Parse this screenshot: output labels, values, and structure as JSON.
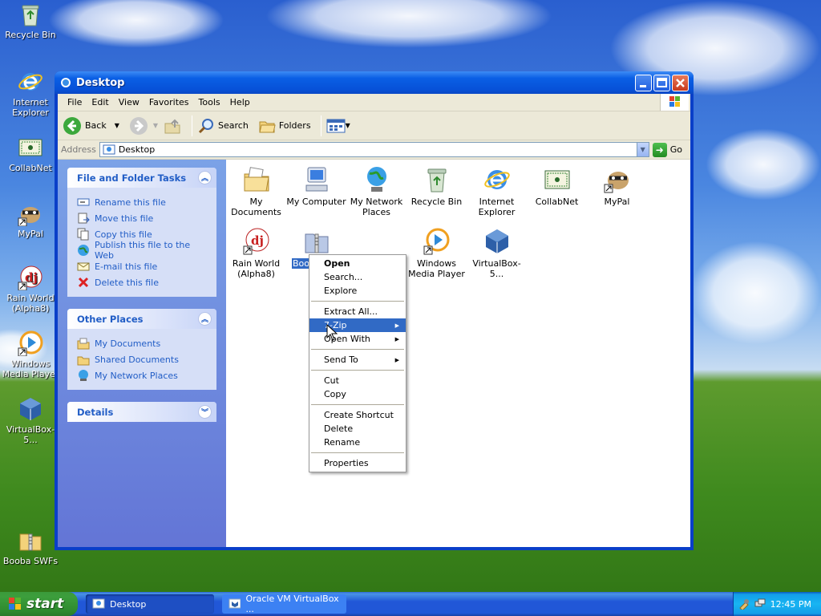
{
  "desktop": {
    "icons": [
      {
        "label": "Recycle Bin",
        "icon": "recycle-bin-icon"
      },
      {
        "label": "Internet Explorer",
        "icon": "internet-explorer-icon"
      },
      {
        "label": "CollabNet",
        "icon": "collabnet-icon"
      },
      {
        "label": "MyPal",
        "icon": "mypal-icon"
      },
      {
        "label": "Rain World (Alpha8)",
        "icon": "rain-world-icon"
      },
      {
        "label": "Windows Media Player",
        "icon": "windows-media-player-icon"
      },
      {
        "label": "VirtualBox-5...",
        "icon": "virtualbox-icon"
      },
      {
        "label": "Booba SWFs",
        "icon": "zip-folder-icon"
      }
    ]
  },
  "window": {
    "title": "Desktop",
    "menu": [
      "File",
      "Edit",
      "View",
      "Favorites",
      "Tools",
      "Help"
    ],
    "toolbar": {
      "back": "Back",
      "search": "Search",
      "folders": "Folders"
    },
    "address": {
      "label": "Address",
      "value": "Desktop",
      "go": "Go"
    },
    "tasks_panel": {
      "title": "File and Folder Tasks",
      "items": [
        "Rename this file",
        "Move this file",
        "Copy this file",
        "Publish this file to the Web",
        "E-mail this file",
        "Delete this file"
      ]
    },
    "other_places": {
      "title": "Other Places",
      "items": [
        "My Documents",
        "Shared Documents",
        "My Network Places"
      ]
    },
    "details": {
      "title": "Details"
    },
    "files": [
      {
        "label": "My Documents"
      },
      {
        "label": "My Computer"
      },
      {
        "label": "My Network Places"
      },
      {
        "label": "Recycle Bin"
      },
      {
        "label": "Internet Explorer"
      },
      {
        "label": "CollabNet"
      },
      {
        "label": "MyPal"
      },
      {
        "label": "Rain World (Alpha8)"
      },
      {
        "label": "Boob"
      },
      {
        "label": "Windows Media Player"
      },
      {
        "label": "VirtualBox-5..."
      }
    ]
  },
  "context_menu": {
    "items": [
      "Open",
      "Search...",
      "Explore",
      "Extract All...",
      "7-Zip",
      "Open With",
      "Send To",
      "Cut",
      "Copy",
      "Create Shortcut",
      "Delete",
      "Rename",
      "Properties"
    ],
    "highlighted": "7-Zip"
  },
  "taskbar": {
    "start": "start",
    "tasks": [
      "Desktop",
      "Oracle VM VirtualBox ..."
    ],
    "clock": "12:45 PM"
  },
  "colors": {
    "xp_blue": "#0a5fe5",
    "selection": "#316ac5",
    "task_link": "#215dc6",
    "start_green": "#3c9e3c"
  }
}
